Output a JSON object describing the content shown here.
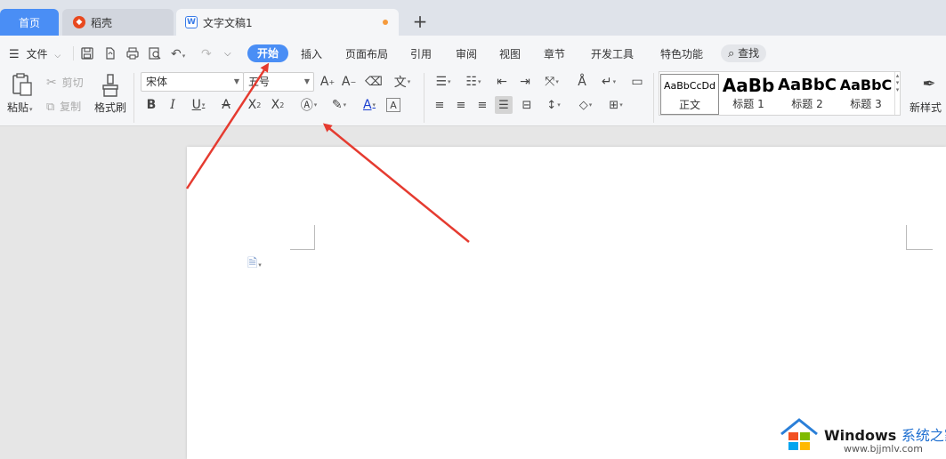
{
  "tabs": {
    "home": "首页",
    "daoke": "稻壳",
    "doc": "文字文稿1",
    "new_tab": "+"
  },
  "menu": {
    "file": "文件",
    "items": [
      "开始",
      "插入",
      "页面布局",
      "引用",
      "审阅",
      "视图",
      "章节",
      "开发工具",
      "特色功能"
    ],
    "active": "开始",
    "search": "查找"
  },
  "ribbon": {
    "paste": "粘贴",
    "cut": "剪切",
    "copy": "复制",
    "format_painter": "格式刷",
    "font_name": "宋体",
    "font_size": "五号",
    "styles": [
      {
        "sample": "AaBbCcDd",
        "name": "正文"
      },
      {
        "sample": "AaBb",
        "name": "标题 1"
      },
      {
        "sample": "AaBbC",
        "name": "标题 2"
      },
      {
        "sample": "AaBbC",
        "name": "标题 3"
      }
    ],
    "new_style": "新样式"
  },
  "watermark": {
    "brand": "Windows",
    "brand_cn": "系统之家",
    "url": "www.bjjmlv.com"
  },
  "colors": {
    "accent": "#4a8ef5",
    "arrow": "#e53b30"
  }
}
